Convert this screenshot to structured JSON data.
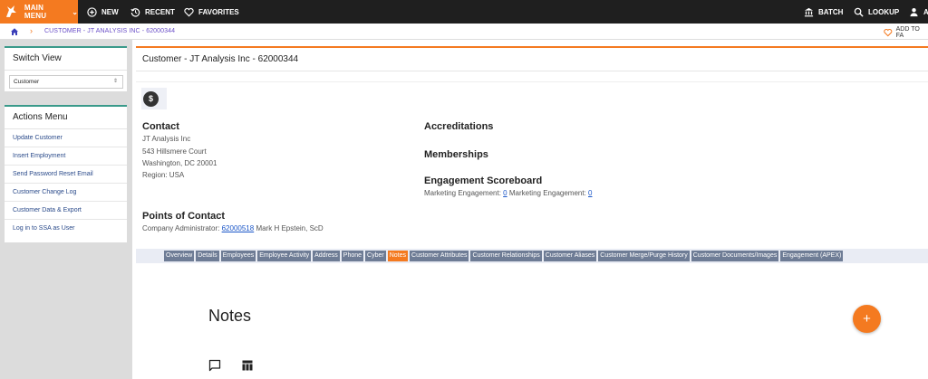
{
  "topbar": {
    "main_menu": "MAIN MENU",
    "new": "NEW",
    "recent": "RECENT",
    "favorites": "FAVORITES",
    "batch": "BATCH",
    "lookup": "LOOKUP",
    "account_partial": "AC"
  },
  "breadcrumb": {
    "current": "CUSTOMER - JT ANALYSIS INC - 62000344",
    "add_to_favorites": "ADD TO FA"
  },
  "sidebar": {
    "switch_view": {
      "heading": "Switch View",
      "selected": "Customer"
    },
    "actions_menu": {
      "heading": "Actions Menu",
      "items": [
        "Update Customer",
        "Insert Employment",
        "Send Password Reset Email",
        "Customer Change Log",
        "Customer Data & Export",
        "Log in to SSA as User"
      ]
    }
  },
  "main": {
    "title": "Customer - JT Analysis Inc - 62000344",
    "contact": {
      "heading": "Contact",
      "name": "JT Analysis Inc",
      "street": "543 Hillsmere Court",
      "city": "Washington, DC 20001",
      "region": "Region: USA"
    },
    "accreditations": "Accreditations",
    "memberships": "Memberships",
    "engagement": {
      "heading": "Engagement Scoreboard",
      "label1": "Marketing Engagement:",
      "value1": "0",
      "label2": "Marketing Engagement:",
      "value2": "0"
    },
    "points_of_contact": {
      "heading": "Points of Contact",
      "label": "Company Administrator:",
      "id": "62000518",
      "name": "Mark H Epstein, ScD"
    },
    "tabs": [
      "Overview",
      "Details",
      "Employees",
      "Employee Activity",
      "Address",
      "Phone",
      "Cyber",
      "Notes",
      "Customer Attributes",
      "Customer Relationships",
      "Customer Aliases",
      "Customer Merge/Purge History",
      "Customer Documents/Images",
      "Engagement (APEX)"
    ],
    "active_tab": "Notes",
    "notes_heading": "Notes",
    "add_button": "+"
  },
  "colors": {
    "accent": "#f47a20",
    "topbar": "#1f1f1f",
    "tab": "#6e7c95",
    "link": "#1a56c8",
    "panel_border": "#3a9a8a"
  },
  "icons": [
    "fox-logo-icon",
    "plus-circle-icon",
    "history-icon",
    "heart-icon",
    "bank-icon",
    "search-icon",
    "user-icon",
    "home-icon",
    "chevron-right-icon",
    "dollar-icon",
    "comment-icon",
    "table-icon"
  ]
}
